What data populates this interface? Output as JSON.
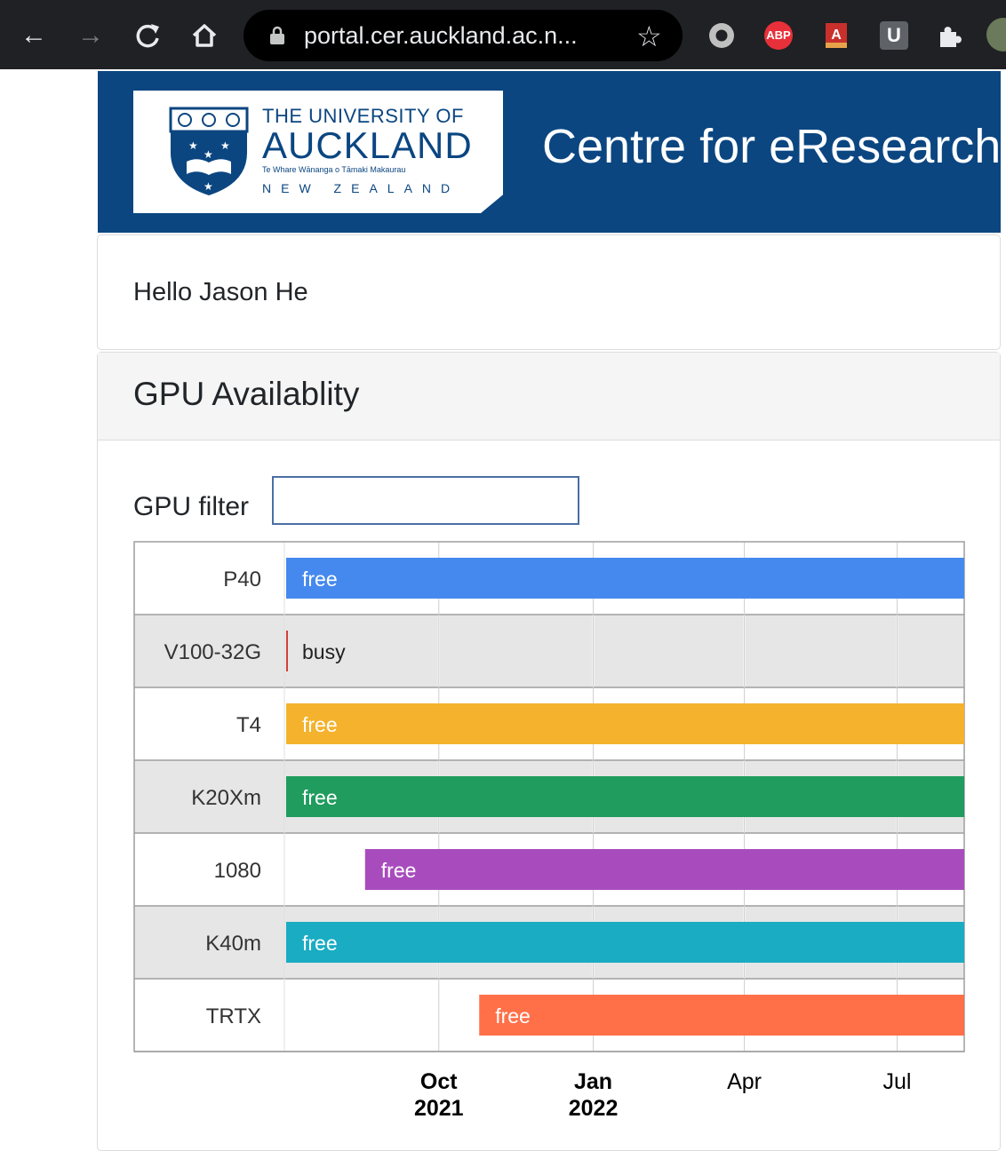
{
  "browser": {
    "url": "portal.cer.auckland.ac.n...",
    "extensions": [
      {
        "name": "record-icon",
        "label": ""
      },
      {
        "name": "adblock-icon",
        "label": "ABP"
      },
      {
        "name": "pdf-extension-icon",
        "label": ""
      },
      {
        "name": "u-extension-icon",
        "label": "U"
      },
      {
        "name": "puzzle-icon",
        "label": ""
      }
    ]
  },
  "header": {
    "logo_line1": "THE UNIVERSITY OF",
    "logo_line2": "AUCKLAND",
    "logo_line3": "Te Whare Wānanga o Tāmaki Makaurau",
    "logo_line4": "NEW ZEALAND",
    "site_title": "Centre for eResearch"
  },
  "greeting": "Hello Jason He",
  "gpu_panel": {
    "title": "GPU Availablity",
    "filter_label": "GPU filter",
    "filter_value": ""
  },
  "chart_data": {
    "type": "timeline",
    "rows": [
      {
        "label": "P40",
        "status": "free",
        "start": "2021-07-01",
        "end": "2022-08-10",
        "color": "#4589ee"
      },
      {
        "label": "V100-32G",
        "status": "busy",
        "start": "2021-07-01",
        "end": "2021-07-02",
        "color": "#d0413a"
      },
      {
        "label": "T4",
        "status": "free",
        "start": "2021-07-01",
        "end": "2022-08-10",
        "color": "#f4b22d"
      },
      {
        "label": "K20Xm",
        "status": "free",
        "start": "2021-07-01",
        "end": "2022-08-10",
        "color": "#1f9c5e"
      },
      {
        "label": "1080",
        "status": "free",
        "start": "2021-08-17",
        "end": "2022-08-10",
        "color": "#a84cbd"
      },
      {
        "label": "K40m",
        "status": "free",
        "start": "2021-07-01",
        "end": "2022-08-10",
        "color": "#1aacc2"
      },
      {
        "label": "TRTX",
        "status": "free",
        "start": "2021-10-24",
        "end": "2022-08-10",
        "color": "#ff7049"
      }
    ],
    "x_ticks": [
      {
        "date": "2021-10-01",
        "line1": "Oct",
        "line2": "2021",
        "bold": true
      },
      {
        "date": "2022-01-01",
        "line1": "Jan",
        "line2": "2022",
        "bold": true
      },
      {
        "date": "2022-04-01",
        "line1": "Apr",
        "line2": "",
        "bold": false
      },
      {
        "date": "2022-07-01",
        "line1": "Jul",
        "line2": "",
        "bold": false
      }
    ],
    "x_range": [
      "2021-07-01",
      "2022-08-10"
    ]
  }
}
